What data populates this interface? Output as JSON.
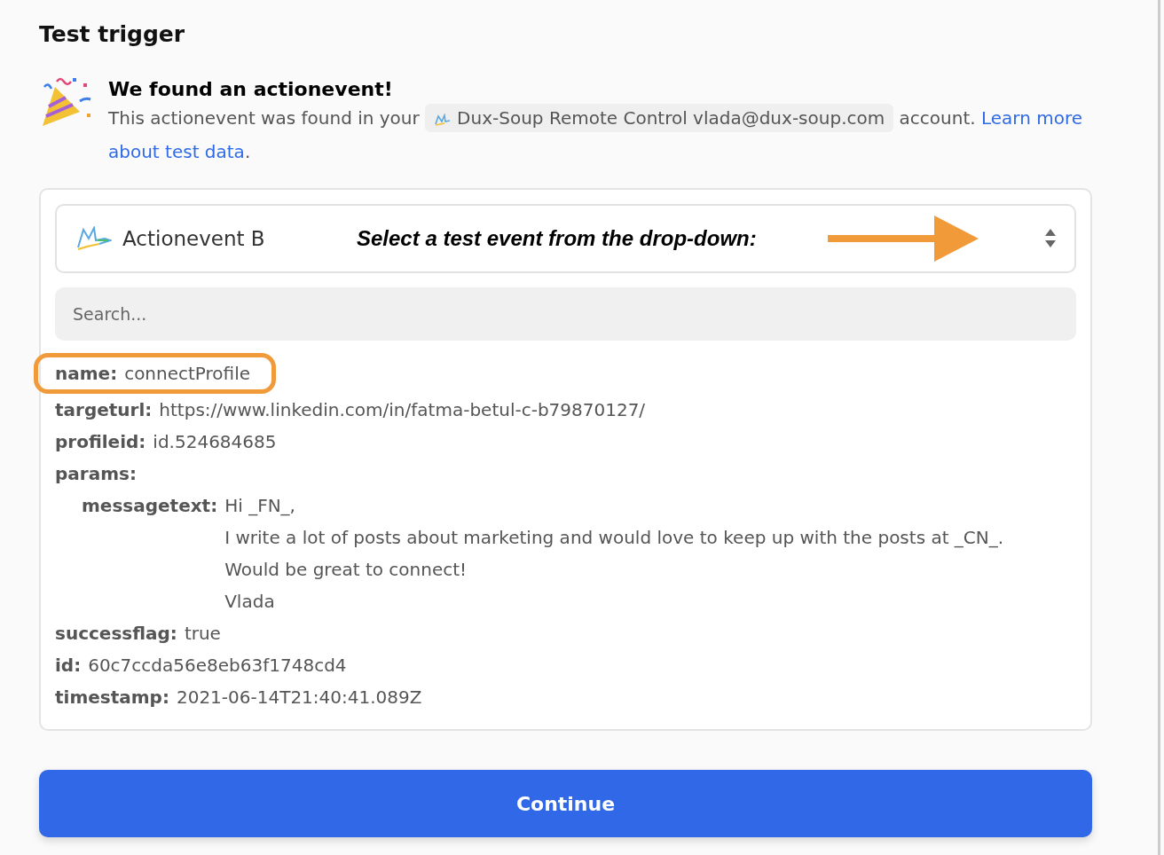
{
  "title": "Test trigger",
  "found": {
    "heading": "We found an actionevent!",
    "text_before": "This actionevent was found in your",
    "account": "Dux-Soup Remote Control vlada@dux-soup.com",
    "text_after": "account.",
    "link_lines": [
      "Learn more",
      "about test data"
    ],
    "end": "."
  },
  "dropdown": {
    "value": "Actionevent B",
    "annotation": "Select a test event from the drop-down:"
  },
  "search": {
    "placeholder": "Search..."
  },
  "fields": [
    {
      "key": "name:",
      "value": [
        "connectProfile"
      ],
      "highlighted": true
    },
    {
      "key": "targeturl:",
      "value": [
        "https://www.linkedin.com/in/fatma-betul-c-b79870127/"
      ],
      "highlighted": false
    },
    {
      "key": "profileid:",
      "value": [
        "id.524684685"
      ],
      "highlighted": false
    },
    {
      "key": "params:",
      "highlighted": false,
      "children": [
        {
          "key": "messagetext:",
          "value": [
            "Hi _FN_,",
            "I write a lot of posts about marketing and would love to keep up with the posts at _CN_.",
            "Would be great to connect!",
            "Vlada"
          ],
          "highlighted": false
        }
      ]
    },
    {
      "key": "successflag:",
      "value": [
        "true"
      ],
      "highlighted": false
    },
    {
      "key": "id:",
      "value": [
        "60c7ccda56e8eb63f1748cd4"
      ],
      "highlighted": false
    },
    {
      "key": "timestamp:",
      "value": [
        "2021-06-14T21:40:41.089Z"
      ],
      "highlighted": false
    }
  ],
  "continue_button": "Continue"
}
